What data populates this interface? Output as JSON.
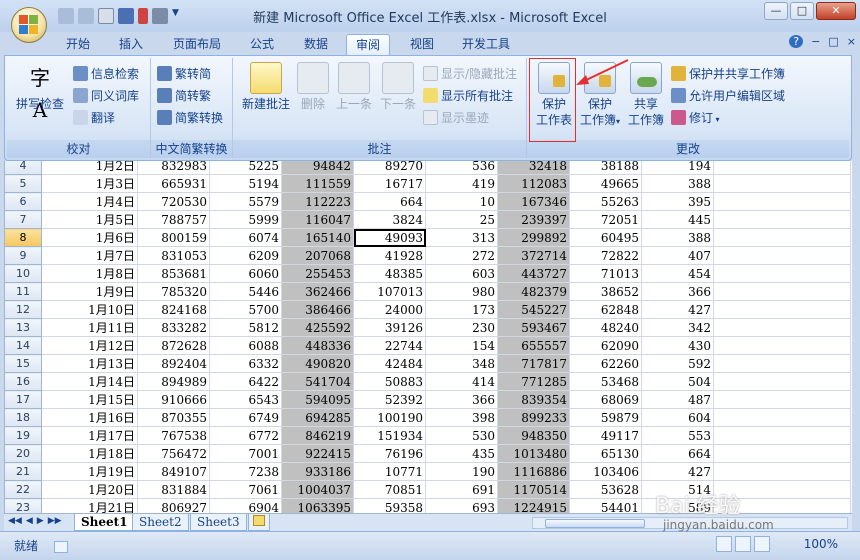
{
  "window": {
    "title": "新建 Microsoft Office Excel 工作表.xlsx - Microsoft Excel",
    "minimize": "—",
    "restore": "□",
    "close": "✕"
  },
  "tabs": [
    {
      "label": "开始"
    },
    {
      "label": "插入"
    },
    {
      "label": "页面布局"
    },
    {
      "label": "公式"
    },
    {
      "label": "数据"
    },
    {
      "label": "审阅"
    },
    {
      "label": "视图"
    },
    {
      "label": "开发工具"
    }
  ],
  "ribbon_right": {
    "help": "?",
    "min": "−",
    "restore": "□",
    "close": "×"
  },
  "ribbon": {
    "proofing": {
      "label": "校对",
      "spellcheck": "拼写检查",
      "research": "信息检索",
      "thesaurus": "同义词库",
      "translate": "翻译"
    },
    "chinese": {
      "label": "中文简繁转换",
      "t2s": "繁转简",
      "s2t": "简转繁",
      "convert": "简繁转换"
    },
    "comments": {
      "label": "批注",
      "new": "新建批注",
      "delete": "删除",
      "prev": "上一条",
      "next": "下一条",
      "showhide": "显示/隐藏批注",
      "showall": "显示所有批注",
      "ink": "显示墨迹"
    },
    "changes": {
      "label": "更改",
      "protect_sheet_1": "保护",
      "protect_sheet_2": "工作表",
      "protect_wb_1": "保护",
      "protect_wb_2": "工作簿",
      "share_1": "共享",
      "share_2": "工作簿",
      "protect_share": "保护并共享工作簿",
      "allow_edit": "允许用户编辑区域",
      "track": "修订"
    }
  },
  "rows": [
    {
      "r": "4",
      "c": [
        "1月2日",
        "832983",
        "5225",
        "94842",
        "89270",
        "536",
        "32418",
        "38188",
        "194"
      ]
    },
    {
      "r": "5",
      "c": [
        "1月3日",
        "665931",
        "5194",
        "111559",
        "16717",
        "419",
        "112083",
        "49665",
        "388"
      ]
    },
    {
      "r": "6",
      "c": [
        "1月4日",
        "720530",
        "5579",
        "112223",
        "664",
        "10",
        "167346",
        "55263",
        "395"
      ]
    },
    {
      "r": "7",
      "c": [
        "1月5日",
        "788757",
        "5999",
        "116047",
        "3824",
        "25",
        "239397",
        "72051",
        "445"
      ]
    },
    {
      "r": "8",
      "c": [
        "1月6日",
        "800159",
        "6074",
        "165140",
        "49093",
        "313",
        "299892",
        "60495",
        "388"
      ]
    },
    {
      "r": "9",
      "c": [
        "1月7日",
        "831053",
        "6209",
        "207068",
        "41928",
        "272",
        "372714",
        "72822",
        "407"
      ]
    },
    {
      "r": "10",
      "c": [
        "1月8日",
        "853681",
        "6060",
        "255453",
        "48385",
        "603",
        "443727",
        "71013",
        "454"
      ]
    },
    {
      "r": "11",
      "c": [
        "1月9日",
        "785320",
        "5446",
        "362466",
        "107013",
        "980",
        "482379",
        "38652",
        "366"
      ]
    },
    {
      "r": "12",
      "c": [
        "1月10日",
        "824168",
        "5700",
        "386466",
        "24000",
        "173",
        "545227",
        "62848",
        "427"
      ]
    },
    {
      "r": "13",
      "c": [
        "1月11日",
        "833282",
        "5812",
        "425592",
        "39126",
        "230",
        "593467",
        "48240",
        "342"
      ]
    },
    {
      "r": "14",
      "c": [
        "1月12日",
        "872628",
        "6088",
        "448336",
        "22744",
        "154",
        "655557",
        "62090",
        "430"
      ]
    },
    {
      "r": "15",
      "c": [
        "1月13日",
        "892404",
        "6332",
        "490820",
        "42484",
        "348",
        "717817",
        "62260",
        "592"
      ]
    },
    {
      "r": "16",
      "c": [
        "1月14日",
        "894989",
        "6422",
        "541704",
        "50883",
        "414",
        "771285",
        "53468",
        "504"
      ]
    },
    {
      "r": "17",
      "c": [
        "1月15日",
        "910666",
        "6543",
        "594095",
        "52392",
        "366",
        "839354",
        "68069",
        "487"
      ]
    },
    {
      "r": "18",
      "c": [
        "1月16日",
        "870355",
        "6749",
        "694285",
        "100190",
        "398",
        "899233",
        "59879",
        "604"
      ]
    },
    {
      "r": "19",
      "c": [
        "1月17日",
        "767538",
        "6772",
        "846219",
        "151934",
        "530",
        "948350",
        "49117",
        "553"
      ]
    },
    {
      "r": "20",
      "c": [
        "1月18日",
        "756472",
        "7001",
        "922415",
        "76196",
        "435",
        "1013480",
        "65130",
        "664"
      ]
    },
    {
      "r": "21",
      "c": [
        "1月19日",
        "849107",
        "7238",
        "933186",
        "10771",
        "190",
        "1116886",
        "103406",
        "427"
      ]
    },
    {
      "r": "22",
      "c": [
        "1月20日",
        "831884",
        "7061",
        "1004037",
        "70851",
        "691",
        "1170514",
        "53628",
        "514"
      ]
    },
    {
      "r": "23",
      "c": [
        "1月21日",
        "806927",
        "6904",
        "1063395",
        "59358",
        "693",
        "1224915",
        "54401",
        "589"
      ]
    }
  ],
  "sheets": [
    {
      "label": "Sheet1"
    },
    {
      "label": "Sheet2"
    },
    {
      "label": "Sheet3"
    }
  ],
  "sheetnav": {
    "first": "◀◀",
    "prev": "◀",
    "next": "▶",
    "last": "▶▶"
  },
  "status": {
    "ready": "就绪",
    "zoom": "100%"
  },
  "watermark": {
    "brand": "Bai 经验",
    "url": "jingyan.baidu.com"
  },
  "colors": {
    "accent": "#15428b",
    "highlight": "#e03030",
    "grey_col": "#c0c0c0"
  }
}
